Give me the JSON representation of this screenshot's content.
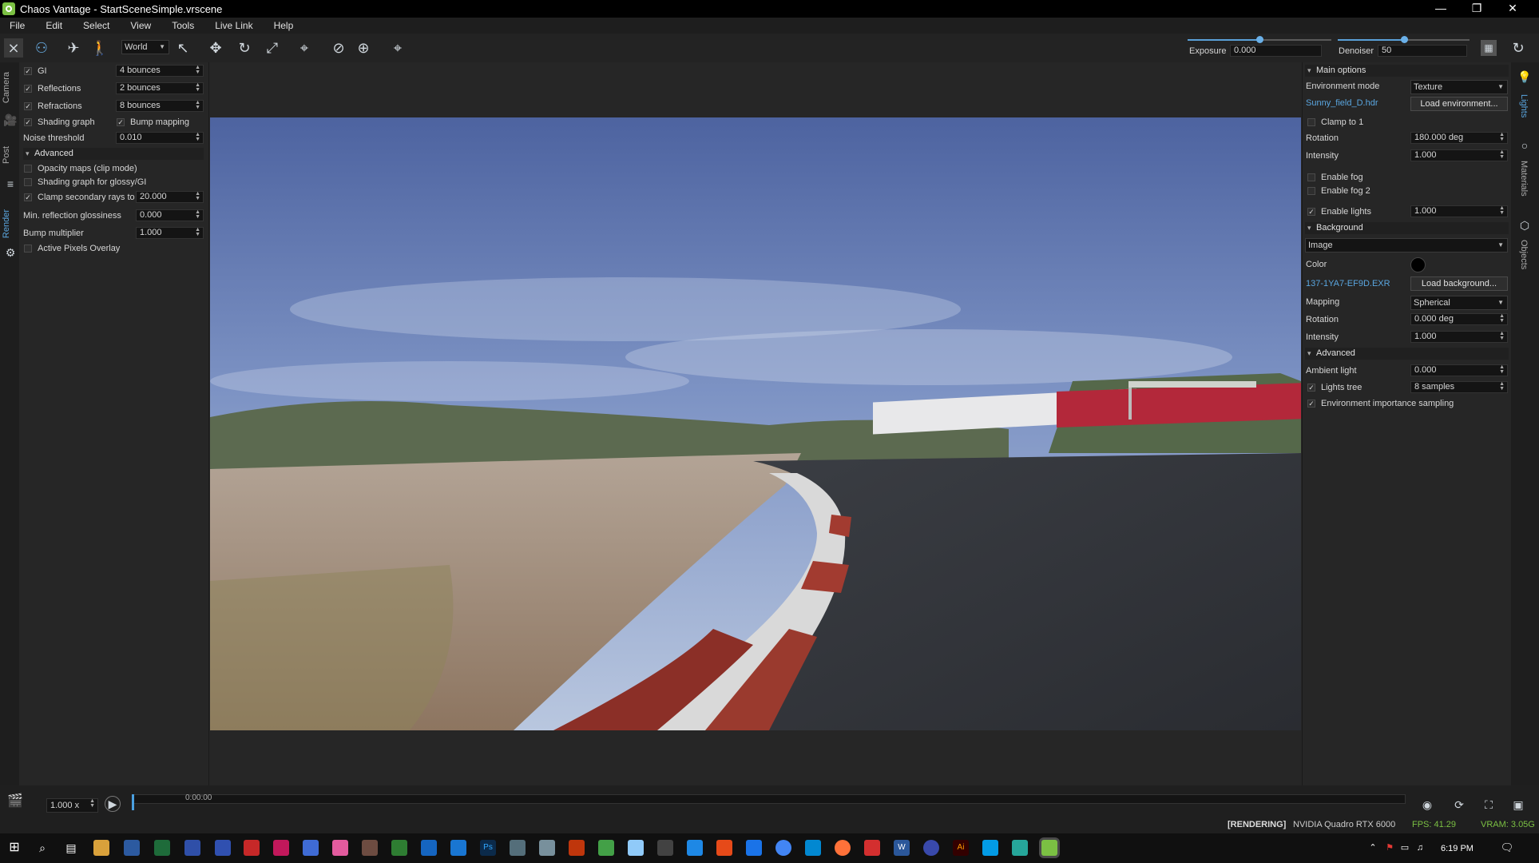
{
  "window": {
    "title": "Chaos Vantage - StartSceneSimple.vrscene",
    "minimize": "—",
    "restore": "❐",
    "close": "✕"
  },
  "menu": [
    "File",
    "Edit",
    "Select",
    "View",
    "Tools",
    "Live Link",
    "Help"
  ],
  "toolbar": {
    "space_select": "World",
    "exposure_label": "Exposure",
    "exposure_value": "0.000",
    "exposure_level": 0.5,
    "denoiser_label": "Denoiser",
    "denoiser_value": "50",
    "denoiser_level": 0.5,
    "icons": [
      "camera-nav-icon",
      "navigate-icon",
      "fly-icon",
      "walk-icon",
      "select-arrow-icon",
      "move-icon",
      "rotate-icon",
      "scale-icon",
      "pivot-icon",
      "snap-icon",
      "isolate-icon",
      "focus-icon"
    ]
  },
  "left_tabs": [
    "Camera",
    "Post",
    "Render"
  ],
  "right_tabs": [
    "Lights",
    "Materials",
    "Objects"
  ],
  "render_panel": {
    "gi": {
      "label": "GI",
      "value": "4 bounces",
      "checked": true
    },
    "reflections": {
      "label": "Reflections",
      "value": "2 bounces",
      "checked": true
    },
    "refractions": {
      "label": "Refractions",
      "value": "8 bounces",
      "checked": true
    },
    "shading_graph": {
      "label": "Shading graph",
      "checked": true
    },
    "bump_mapping": {
      "label": "Bump mapping",
      "checked": true
    },
    "noise_threshold": {
      "label": "Noise threshold",
      "value": "0.010"
    },
    "advanced_label": "Advanced",
    "opacity_maps": {
      "label": "Opacity maps (clip mode)",
      "checked": false
    },
    "shading_graph_glossy": {
      "label": "Shading graph for glossy/GI",
      "checked": false
    },
    "clamp_secondary": {
      "label": "Clamp secondary rays to",
      "value": "20.000",
      "checked": true
    },
    "min_reflection_glossiness": {
      "label": "Min. reflection glossiness",
      "value": "0.000"
    },
    "bump_multiplier": {
      "label": "Bump multiplier",
      "value": "1.000"
    },
    "active_pixels_overlay": {
      "label": "Active Pixels Overlay",
      "checked": false
    }
  },
  "lights_panel": {
    "main_options": "Main options",
    "environment_mode": {
      "label": "Environment mode",
      "value": "Texture"
    },
    "env_file": "Sunny_field_D.hdr",
    "load_environment": "Load environment...",
    "clamp_to_1": {
      "label": "Clamp to 1",
      "checked": false
    },
    "rotation": {
      "label": "Rotation",
      "value": "180.000 deg"
    },
    "intensity": {
      "label": "Intensity",
      "value": "1.000"
    },
    "enable_fog": {
      "label": "Enable fog",
      "checked": false
    },
    "enable_fog2": {
      "label": "Enable fog 2",
      "checked": false
    },
    "enable_lights": {
      "label": "Enable lights",
      "value": "1.000",
      "checked": true
    },
    "background_section": "Background",
    "background_mode": "Image",
    "color_label": "Color",
    "color_value": "#000000",
    "bg_file": "137-1YA7-EF9D.EXR",
    "load_background": "Load background...",
    "mapping": {
      "label": "Mapping",
      "value": "Spherical"
    },
    "bg_rotation": {
      "label": "Rotation",
      "value": "0.000 deg"
    },
    "bg_intensity": {
      "label": "Intensity",
      "value": "1.000"
    },
    "advanced_section": "Advanced",
    "ambient_light": {
      "label": "Ambient light",
      "value": "0.000"
    },
    "lights_tree": {
      "label": "Lights tree",
      "value": "8 samples",
      "checked": true
    },
    "env_importance": {
      "label": "Environment importance sampling",
      "checked": true
    }
  },
  "timeline": {
    "speed": "1.000 x",
    "time": "0:00:00"
  },
  "status": {
    "state": "[RENDERING]",
    "gpu": "NVIDIA Quadro RTX 6000",
    "fps": "FPS: 41.29",
    "vram": "VRAM: 3.05G"
  },
  "taskbar": {
    "clock": "6:19 PM"
  }
}
